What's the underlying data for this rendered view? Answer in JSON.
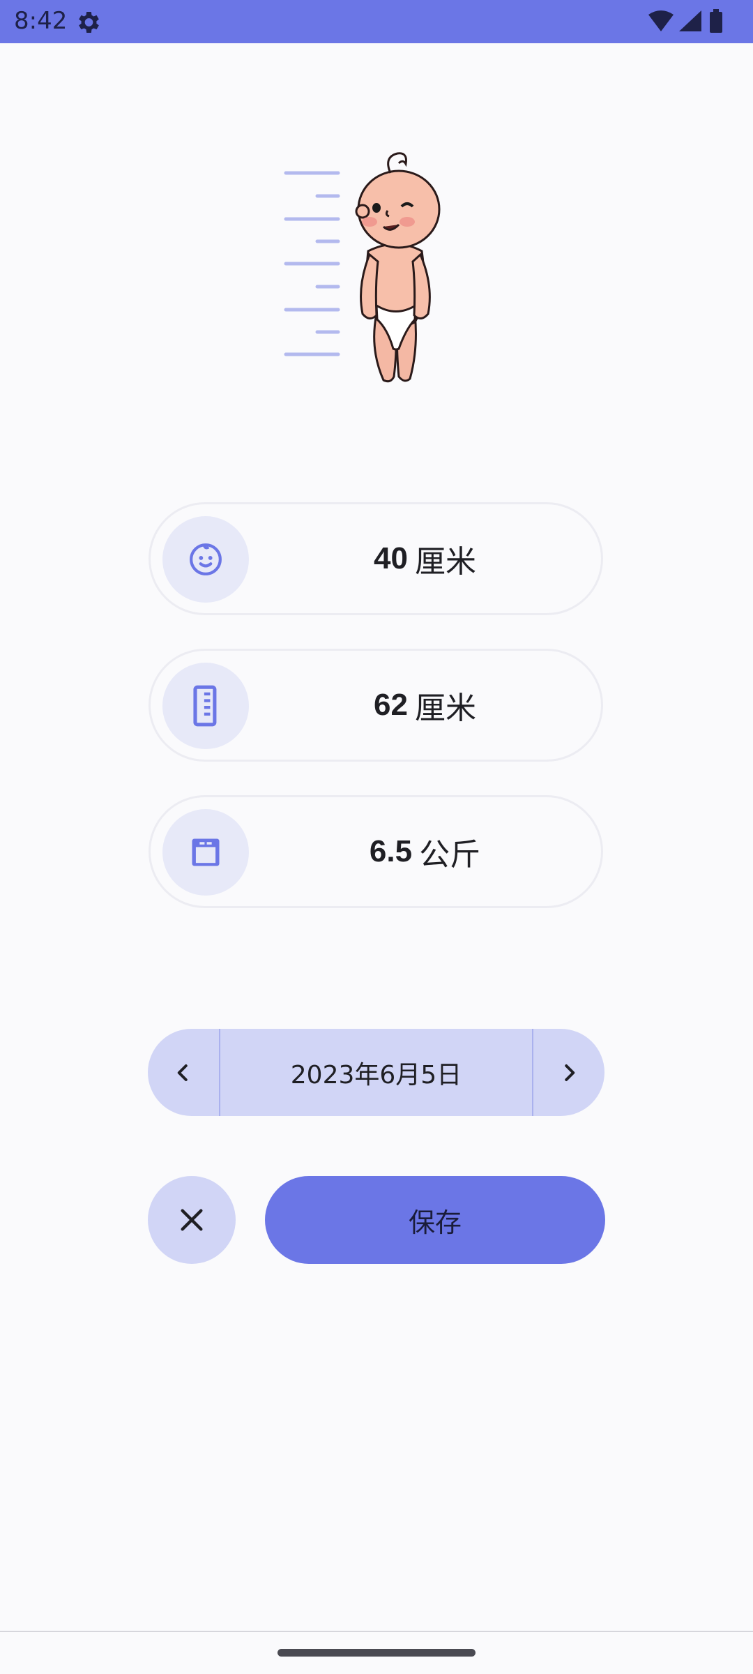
{
  "status_bar": {
    "time": "8:42",
    "icons": [
      "settings-gear-icon",
      "wifi-icon",
      "signal-icon",
      "battery-icon"
    ],
    "background": "#6b76e6"
  },
  "illustration": "baby-height-chart-illustration",
  "measurements": [
    {
      "icon": "baby-face-icon",
      "value": "40",
      "unit": "厘米"
    },
    {
      "icon": "ruler-icon",
      "value": "62",
      "unit": "厘米"
    },
    {
      "icon": "scale-icon",
      "value": "6.5",
      "unit": "公斤"
    }
  ],
  "date_selector": {
    "date": "2023年6月5日",
    "prev_icon": "chevron-left-icon",
    "next_icon": "chevron-right-icon"
  },
  "actions": {
    "cancel_icon": "close-icon",
    "save_label": "保存"
  },
  "colors": {
    "accent": "#6b76e6",
    "accent_light": "#d1d5f6",
    "icon_bg": "#e7e9f8"
  }
}
